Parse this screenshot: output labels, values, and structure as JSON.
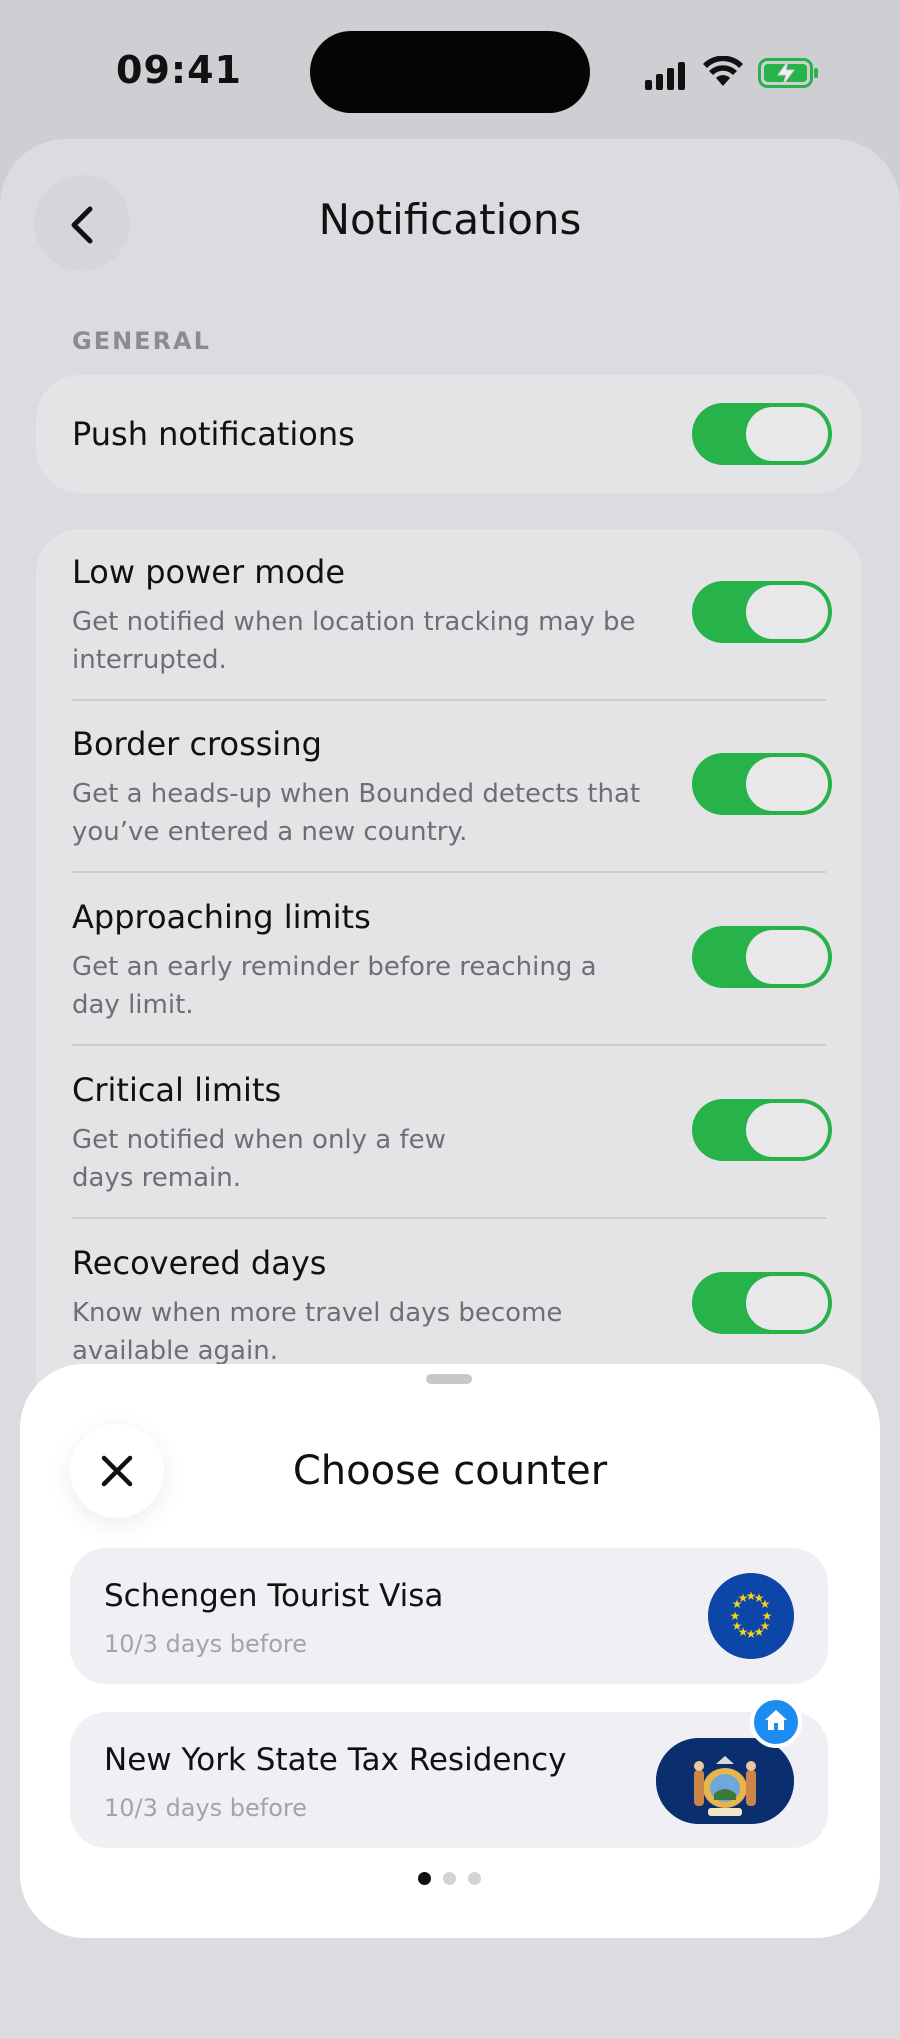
{
  "status_bar": {
    "time": "09:41"
  },
  "header": {
    "title": "Notifications"
  },
  "general": {
    "section_label": "GENERAL",
    "push": {
      "label": "Push notifications",
      "enabled": true
    }
  },
  "settings": [
    {
      "title": "Low power mode",
      "description": "Get notified when location tracking may be interrupted.",
      "enabled": true
    },
    {
      "title": "Border crossing",
      "description": "Get a heads-up when Bounded detects that you’ve entered a new country.",
      "enabled": true
    },
    {
      "title": "Approaching limits",
      "description": "Get an early reminder before reaching a day limit.",
      "enabled": true
    },
    {
      "title": "Critical limits",
      "description": "Get notified when only a few days remain.",
      "enabled": true
    },
    {
      "title": "Recovered days",
      "description": "Know when more travel days become available again.",
      "enabled": true
    }
  ],
  "sheet": {
    "title": "Choose counter",
    "counters": [
      {
        "name": "Schengen Tourist Visa",
        "subtitle": "10/3 days before",
        "icon": "eu-flag-icon"
      },
      {
        "name": "New York State Tax Residency",
        "subtitle": "10/3 days before",
        "icon": "new-york-flag-icon",
        "badge": "home-icon"
      }
    ],
    "page_indicator": {
      "pages": 3,
      "current": 1
    }
  },
  "colors": {
    "toggle_on": "#27b24a",
    "eu_blue": "#0b46a8",
    "ny_blue": "#0b2f6e",
    "badge_blue": "#1d8cf0"
  }
}
